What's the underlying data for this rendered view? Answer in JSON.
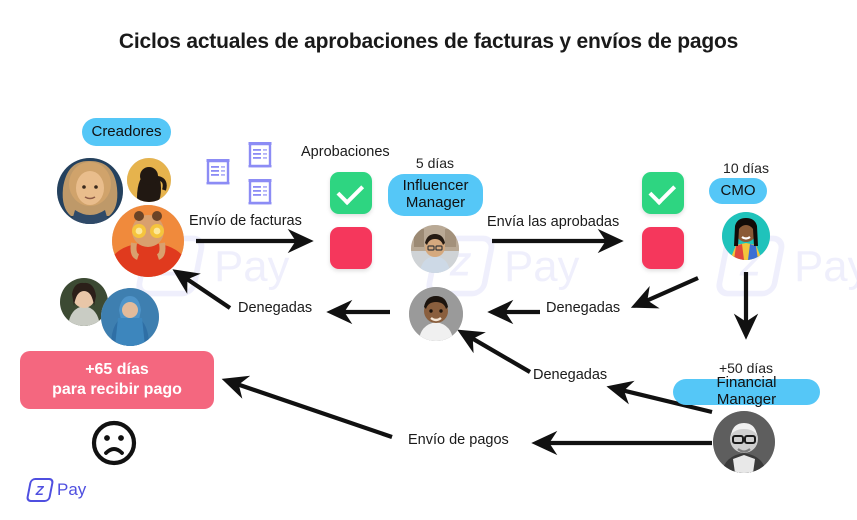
{
  "page": {
    "title": "Ciclos actuales de aprobaciones de facturas y envíos de pagos",
    "background": "#ffffff"
  },
  "watermark": {
    "z_glyph": "Z",
    "text": "Pay",
    "color": "#4f4fe0"
  },
  "colors": {
    "badge_blue": "#55c7f7",
    "approve_green": "#2ed581",
    "deny_red": "#f5375c",
    "result_pink": "#f4677f",
    "doc_purple": "#8c8cf5",
    "arrow_black": "#111111",
    "brand_blue": "#4f4fe0"
  },
  "creators": {
    "badge_label": "Creadores"
  },
  "documents": {
    "icon_name": "invoice-document-icon",
    "count": 3
  },
  "stage_approvals": {
    "header_label": "Aprobaciones",
    "approve_icon": "check-mark-icon",
    "deny_icon": "deny-square-icon"
  },
  "stage_influencer_manager": {
    "days_label": "5 días",
    "role_label": "Influencer\nManager"
  },
  "stage_cmo": {
    "days_label": "10 días",
    "role_label": "CMO",
    "approve_icon": "check-mark-icon",
    "deny_icon": "deny-square-icon"
  },
  "stage_financial_manager": {
    "days_label": "+50 días",
    "role_label": "Financial Manager"
  },
  "flow_labels": {
    "send_invoices": "Envío de facturas",
    "denied_1": "Denegadas",
    "send_approved": "Envía las aprobadas",
    "denied_2": "Denegadas",
    "denied_3": "Denegadas",
    "send_payments": "Envío de pagos"
  },
  "result": {
    "text": "+65 días\npara recibir pago",
    "face_icon": "sad-face-icon"
  },
  "footer_logo": {
    "z_glyph": "Z",
    "text": "Pay"
  }
}
